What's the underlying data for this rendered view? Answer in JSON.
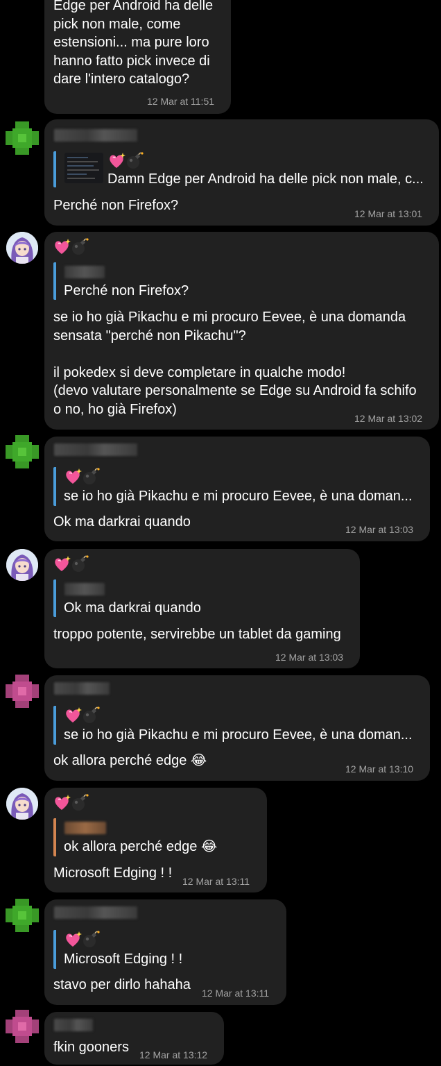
{
  "colors": {
    "background": "#000000",
    "bubble": "#212121",
    "text": "#ffffff",
    "timestamp": "#a3a3a3",
    "reply_bar_blue": "#4a9ddb",
    "reply_bar_orange": "#d48550",
    "avatar_green": "#3fa82a",
    "avatar_pink": "#c04c8e"
  },
  "reaction_icons": [
    "sparkling-heart-icon",
    "bomb-icon"
  ],
  "messages": [
    {
      "text": "Edge per Android ha delle\npick non male, come\nestensioni... ma pure loro\nhanno fatto pick invece di\ndare l'intero catalogo?",
      "time": "12 Mar at 11:51"
    },
    {
      "reply_text": "Damn Edge per Android ha delle pick non male, c...",
      "text": "Perché non Firefox?",
      "time": "12 Mar at 13:01"
    },
    {
      "reply_text": "Perché non Firefox?",
      "text": "se io ho già Pikachu e mi procuro Eevee, è una domanda\nsensata \"perché non Pikachu\"?\n\nil pokedex si deve completare in qualche modo!\n(devo valutare personalmente se Edge su Android fa schifo\no no, ho già Firefox)",
      "time": "12 Mar at 13:02"
    },
    {
      "reply_text": "se io ho già Pikachu e mi procuro Eevee, è una doman...",
      "text": "Ok ma darkrai quando",
      "time": "12 Mar at 13:03"
    },
    {
      "reply_text": "Ok ma darkrai quando",
      "text": "troppo potente, servirebbe un tablet da gaming",
      "time": "12 Mar at 13:03"
    },
    {
      "reply_text": "se io ho già Pikachu e mi procuro Eevee, è una doman...",
      "text": "ok allora perché edge 😂",
      "time": "12 Mar at 13:10"
    },
    {
      "reply_text": "ok allora perché edge 😂",
      "text": "Microsoft Edging ! !",
      "time": "12 Mar at 13:11"
    },
    {
      "reply_text": "Microsoft Edging ! !",
      "text": "stavo per dirlo hahaha",
      "time": "12 Mar at 13:11"
    },
    {
      "text": "fkin gooners",
      "time": "12 Mar at 13:12"
    }
  ]
}
